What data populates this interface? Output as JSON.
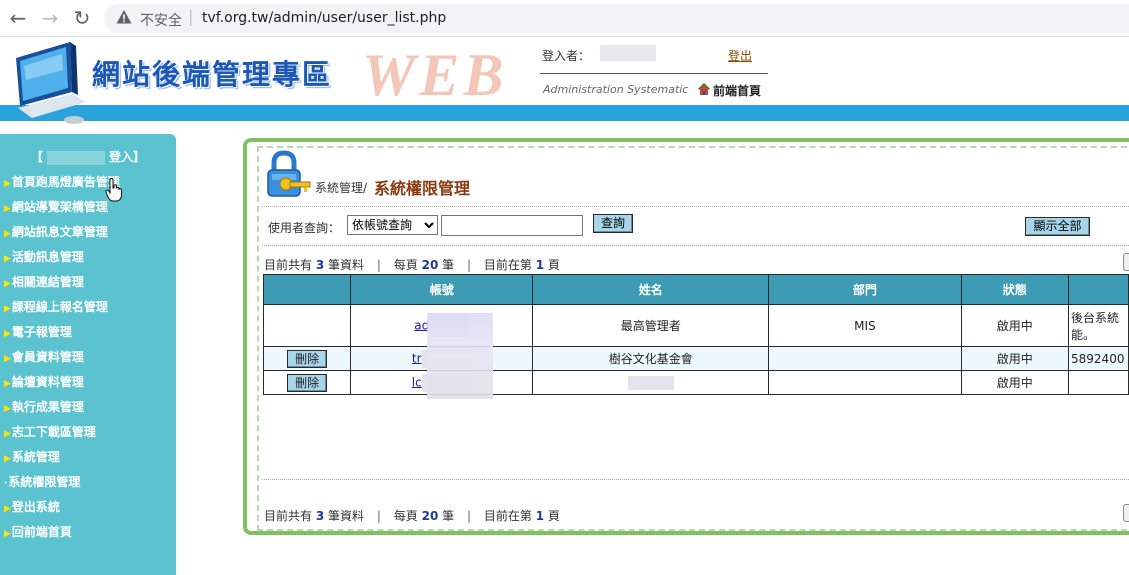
{
  "browser": {
    "back": "←",
    "forward": "→",
    "reload": "↻",
    "security_label": "不安全",
    "url": "tvf.org.tw/admin/user/user_list.php"
  },
  "header": {
    "site_title": "網站後端管理專區",
    "web_word": "WEB",
    "login_label": "登入者：",
    "logout": "登出",
    "admin_systematic": "Administration Systematic",
    "front_home": "前端首頁",
    "accent_color": "#2aa3dc"
  },
  "sidebar": {
    "login_open": "【",
    "login_close": "登入】",
    "items": [
      {
        "label": "首頁跑馬燈廣告管理"
      },
      {
        "label": "網站導覽架構管理"
      },
      {
        "label": "網站訊息文章管理"
      },
      {
        "label": "活動訊息管理"
      },
      {
        "label": "相關連結管理"
      },
      {
        "label": "課程線上報名管理"
      },
      {
        "label": "電子報管理"
      },
      {
        "label": "會員資料管理"
      },
      {
        "label": "論壇資料管理"
      },
      {
        "label": "執行成果管理"
      },
      {
        "label": "志工下載區管理"
      },
      {
        "label": "系統管理"
      },
      {
        "label": "系統權限管理"
      },
      {
        "label": "登出系統"
      },
      {
        "label": "回前端首頁"
      }
    ],
    "bg_color": "#5bc3cf"
  },
  "main": {
    "breadcrumb_parent": "系統管理/",
    "page_title": "系統權限管理",
    "search": {
      "label": "使用者查詢：",
      "select_value": "依帳號查詢",
      "input_value": "",
      "query_button": "查詢",
      "show_all_button": "顯示全部"
    },
    "pager": {
      "total_prefix": "目前共有",
      "total_count": "3",
      "total_suffix": "筆資料",
      "per_page_prefix": "每頁",
      "per_page_count": "20",
      "per_page_suffix": "筆",
      "page_prefix": "目前在第",
      "page_number": "1",
      "page_suffix": "頁",
      "separator": "|"
    },
    "table": {
      "headers": [
        "",
        "帳號",
        "姓名",
        "部門",
        "狀態",
        ""
      ],
      "rows": [
        {
          "action": "",
          "account": "ad",
          "name": "最高管理者",
          "dept": "MIS",
          "status": "啟用中",
          "extra": "後台系統能。"
        },
        {
          "action": "刪除",
          "account": "tr",
          "name": "樹谷文化基金會",
          "dept": "",
          "status": "啟用中",
          "extra": "5892400"
        },
        {
          "action": "刪除",
          "account": "lc",
          "name": "",
          "dept": "",
          "status": "啟用中",
          "extra": ""
        }
      ]
    }
  }
}
